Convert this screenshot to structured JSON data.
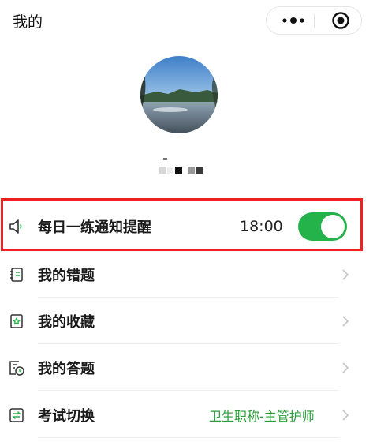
{
  "header": {
    "title": "我的"
  },
  "profile": {
    "avatar_alt": "avatar",
    "nickname": ""
  },
  "reminder": {
    "label": "每日一练通知提醒",
    "time": "18:00",
    "enabled": true
  },
  "menu": {
    "wrong": {
      "label": "我的错题"
    },
    "favorites": {
      "label": "我的收藏"
    },
    "answers": {
      "label": "我的答题"
    },
    "exam_switch": {
      "label": "考试切换",
      "value": "卫生职称-主管护师"
    }
  },
  "colors": {
    "accent": "#24b24a",
    "highlight": "#ee2020",
    "green_text": "#2a9d3a"
  }
}
